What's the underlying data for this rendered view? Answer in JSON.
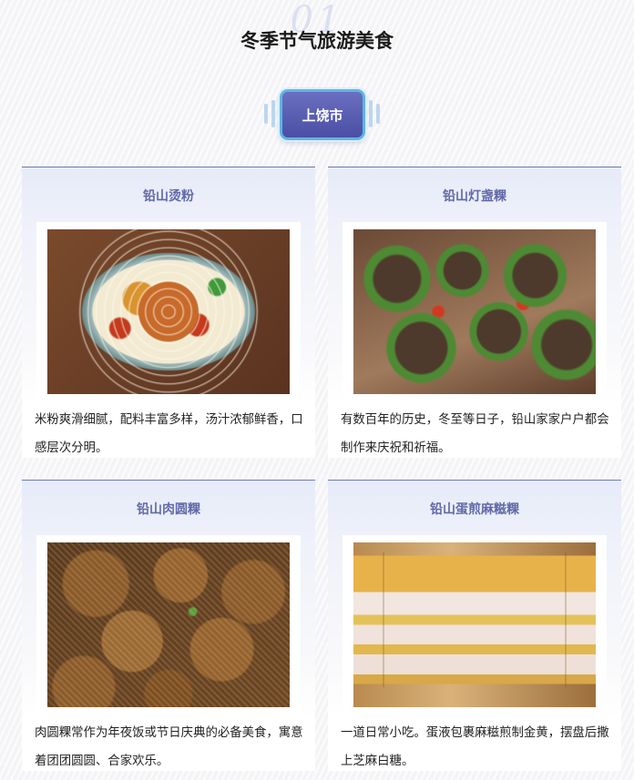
{
  "header": {
    "section_number": "01",
    "title": "冬季节气旅游美食"
  },
  "city": {
    "label": "上饶市"
  },
  "foods": [
    {
      "name": "铅山烫粉",
      "image_icon": "noodle-bowl-photo",
      "description": "米粉爽滑细腻，配料丰富多样，汤汁浓郁鲜香，口感层次分明。"
    },
    {
      "name": "铅山灯盏粿",
      "image_icon": "lamp-cake-photo",
      "description": "有数百年的历史，冬至等日子，铅山家家户户都会制作来庆祝和祈福。"
    },
    {
      "name": "铅山肉圆粿",
      "image_icon": "meatball-cake-photo",
      "description": "肉圆粿常作为年夜饭或节日庆典的必备美食，寓意着团团圆圆、合家欢乐。"
    },
    {
      "name": "铅山蛋煎麻糍粿",
      "image_icon": "fried-mochi-photo",
      "description": "一道日常小吃。蛋液包裹麻糍煎制金黄，摆盘后撒上芝麻白糖。"
    }
  ],
  "colors": {
    "accent": "#5b5fb0",
    "card_name": "#6269a8",
    "card_border": "#6e78b4",
    "button_border": "#5fb4e3"
  }
}
